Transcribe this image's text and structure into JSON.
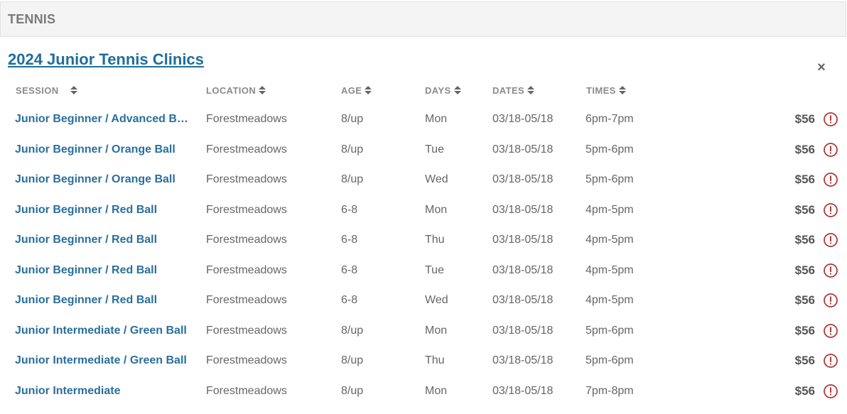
{
  "section": {
    "title": "TENNIS"
  },
  "program": {
    "title": "2024 Junior Tennis Clinics",
    "close_icon": "×"
  },
  "columns": [
    {
      "key": "session",
      "label": "SESSION"
    },
    {
      "key": "location",
      "label": "LOCATION"
    },
    {
      "key": "age",
      "label": "AGE"
    },
    {
      "key": "days",
      "label": "DAYS"
    },
    {
      "key": "dates",
      "label": "DATES"
    },
    {
      "key": "times",
      "label": "TIMES"
    }
  ],
  "rows": [
    {
      "session": "Junior Beginner / Advanced B…",
      "location": "Forestmeadows",
      "age": "8/up",
      "days": "Mon",
      "dates": "03/18-05/18",
      "times": "6pm-7pm",
      "price": "$56"
    },
    {
      "session": "Junior Beginner / Orange Ball",
      "location": "Forestmeadows",
      "age": "8/up",
      "days": "Tue",
      "dates": "03/18-05/18",
      "times": "5pm-6pm",
      "price": "$56"
    },
    {
      "session": "Junior Beginner / Orange Ball",
      "location": "Forestmeadows",
      "age": "8/up",
      "days": "Wed",
      "dates": "03/18-05/18",
      "times": "5pm-6pm",
      "price": "$56"
    },
    {
      "session": "Junior Beginner / Red Ball",
      "location": "Forestmeadows",
      "age": "6-8",
      "days": "Mon",
      "dates": "03/18-05/18",
      "times": "4pm-5pm",
      "price": "$56"
    },
    {
      "session": "Junior Beginner / Red Ball",
      "location": "Forestmeadows",
      "age": "6-8",
      "days": "Thu",
      "dates": "03/18-05/18",
      "times": "4pm-5pm",
      "price": "$56"
    },
    {
      "session": "Junior Beginner / Red Ball",
      "location": "Forestmeadows",
      "age": "6-8",
      "days": "Tue",
      "dates": "03/18-05/18",
      "times": "4pm-5pm",
      "price": "$56"
    },
    {
      "session": "Junior Beginner / Red Ball",
      "location": "Forestmeadows",
      "age": "6-8",
      "days": "Wed",
      "dates": "03/18-05/18",
      "times": "4pm-5pm",
      "price": "$56"
    },
    {
      "session": "Junior Intermediate / Green Ball",
      "location": "Forestmeadows",
      "age": "8/up",
      "days": "Mon",
      "dates": "03/18-05/18",
      "times": "5pm-6pm",
      "price": "$56"
    },
    {
      "session": "Junior Intermediate / Green Ball",
      "location": "Forestmeadows",
      "age": "8/up",
      "days": "Thu",
      "dates": "03/18-05/18",
      "times": "5pm-6pm",
      "price": "$56"
    },
    {
      "session": "Junior Intermediate",
      "location": "Forestmeadows",
      "age": "8/up",
      "days": "Mon",
      "dates": "03/18-05/18",
      "times": "7pm-8pm",
      "price": "$56"
    }
  ],
  "icons": {
    "sort": "sort-icon",
    "alert": "alert-circle-icon",
    "close": "close-icon"
  },
  "colors": {
    "link": "#2a6f9b",
    "title": "#1f6e9c",
    "alert": "#b03a3a",
    "header_bg": "#f4f4f4"
  }
}
